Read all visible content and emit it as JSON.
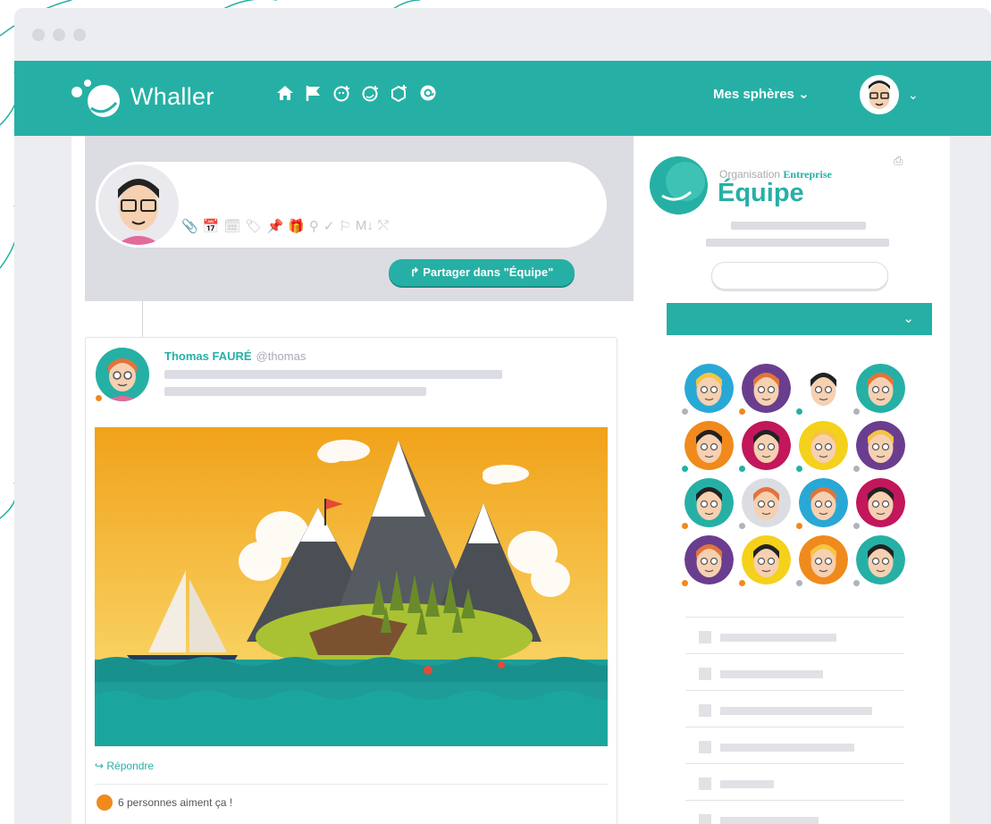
{
  "app": {
    "name": "Whaller"
  },
  "nav": {
    "icons": [
      "home-icon",
      "flag-icon",
      "add-sphere-icon",
      "add-organization-icon",
      "add-box-icon",
      "mention-icon"
    ],
    "spheres_label": "Mes sphères",
    "spheres_chevron": "⌄",
    "user_chevron": "⌄"
  },
  "composer": {
    "tools": [
      "📎",
      "📅",
      "🗓",
      "🏷",
      "📌",
      "🎁",
      "⚲",
      "✓",
      "⚐",
      "M↓",
      "⤲"
    ],
    "share_label": "↱ Partager dans \"Équipe\""
  },
  "post": {
    "author": "Thomas FAURÉ",
    "handle": "@thomas",
    "reply_label": "↪ Répondre",
    "likes_label": "6 personnes aiment ça !"
  },
  "sidebar": {
    "org_prefix": "Organisation",
    "org_name": "Entreprise",
    "sphere_title": "Équipe",
    "print_icon": "⎙",
    "dropdown_chevron": "⌄",
    "members": [
      {
        "bg": "#29a8d6",
        "dot": "#b0b3bb"
      },
      {
        "bg": "#6b3d8f",
        "dot": "#f08a1c"
      },
      {
        "bg": "#ffffff",
        "dot": "#26b0a5"
      },
      {
        "bg": "#26b0a5",
        "dot": "#b0b3bb"
      },
      {
        "bg": "#f08a1c",
        "dot": "#26b0a5"
      },
      {
        "bg": "#c2175b",
        "dot": "#26b0a5"
      },
      {
        "bg": "#f4d11b",
        "dot": "#26b0a5"
      },
      {
        "bg": "#6b3d8f",
        "dot": "#b0b3bb"
      },
      {
        "bg": "#26b0a5",
        "dot": "#f08a1c"
      },
      {
        "bg": "#dcdde2",
        "dot": "#b0b3bb"
      },
      {
        "bg": "#29a8d6",
        "dot": "#f08a1c"
      },
      {
        "bg": "#c2175b",
        "dot": "#b0b3bb"
      },
      {
        "bg": "#6b3d8f",
        "dot": "#f08a1c"
      },
      {
        "bg": "#f4d11b",
        "dot": "#f08a1c"
      },
      {
        "bg": "#f08a1c",
        "dot": "#b0b3bb"
      },
      {
        "bg": "#26b0a5",
        "dot": "#b0b3bb"
      }
    ]
  },
  "colors": {
    "accent": "#26b0a5",
    "orange": "#f08a1c",
    "skeleton": "#dcdde2"
  }
}
